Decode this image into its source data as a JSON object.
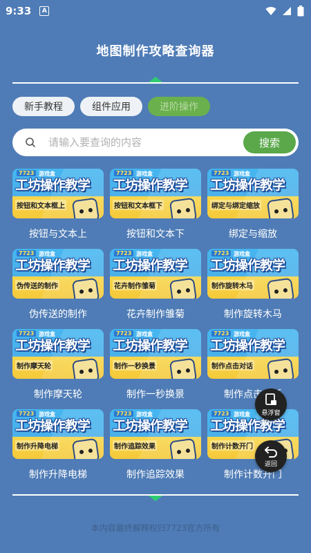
{
  "status": {
    "time": "9:33",
    "notification_glyph": "A"
  },
  "header": {
    "title": "地图制作攻略查询器"
  },
  "tabs": [
    {
      "label": "新手教程",
      "active": false
    },
    {
      "label": "组件应用",
      "active": false
    },
    {
      "label": "进阶操作",
      "active": true
    }
  ],
  "search": {
    "placeholder": "请输入要查询的内容",
    "button_label": "搜索"
  },
  "thumbnail": {
    "brand": "7723",
    "brand_suffix": "游戏盒",
    "title": "工坊操作教学"
  },
  "items": [
    {
      "label": "按钮与文本上",
      "thumb_sub": "按钮和文本框上"
    },
    {
      "label": "按钮和文本下",
      "thumb_sub": "按钮和文本框下"
    },
    {
      "label": "绑定与缩放",
      "thumb_sub": "绑定与绑定缩放"
    },
    {
      "label": "伪传送的制作",
      "thumb_sub": "伪传送的制作"
    },
    {
      "label": "花卉制作雏菊",
      "thumb_sub": "花卉制作雏菊"
    },
    {
      "label": "制作旋转木马",
      "thumb_sub": "制作旋转木马"
    },
    {
      "label": "制作摩天轮",
      "thumb_sub": "制作摩天轮"
    },
    {
      "label": "制作一秒换景",
      "thumb_sub": "制作一秒换景"
    },
    {
      "label": "制作点击对话",
      "thumb_sub": "制作点击对话"
    },
    {
      "label": "制作升降电梯",
      "thumb_sub": "制作升降电梯"
    },
    {
      "label": "制作追踪效果",
      "thumb_sub": "制作追踪效果"
    },
    {
      "label": "制作计数开门",
      "thumb_sub": "制作计数开门"
    }
  ],
  "floating": {
    "window_label": "悬浮窗",
    "back_label": "返回"
  },
  "footer": {
    "text": "本内容最终解释权归7723官方所有"
  },
  "colors": {
    "background": "#4f7cb6",
    "accent_green": "#5aa84a",
    "divider_mark": "#2ecc71"
  }
}
